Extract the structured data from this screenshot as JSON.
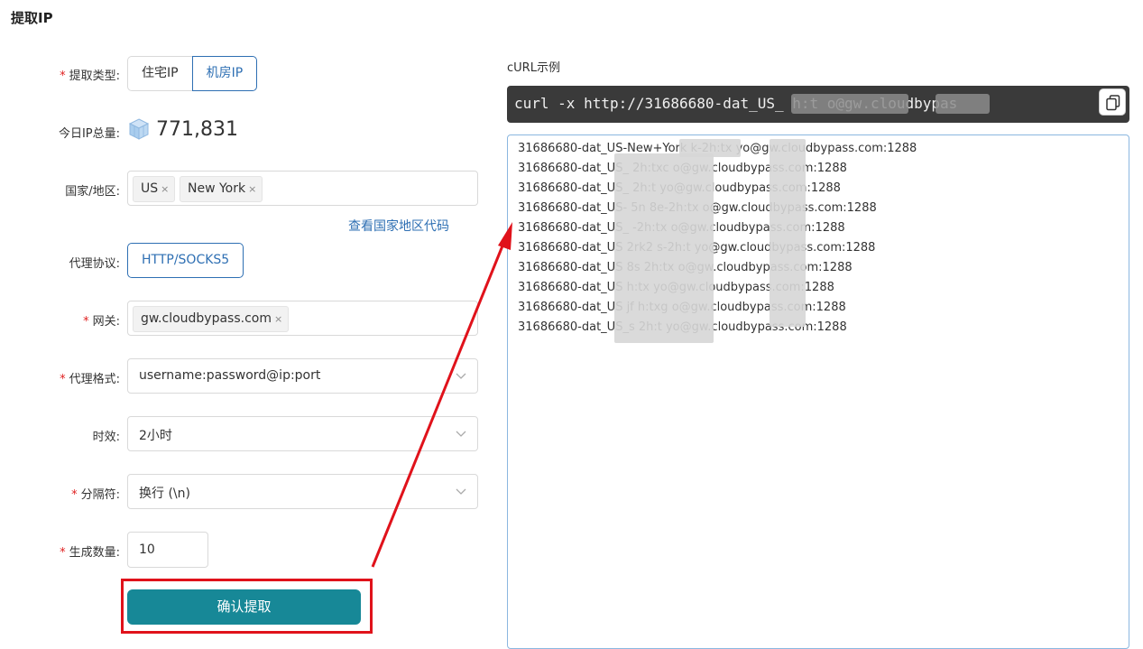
{
  "page": {
    "title": "提取IP"
  },
  "form": {
    "extract_type": {
      "label": "提取类型:",
      "options": [
        "住宅IP",
        "机房IP"
      ],
      "selected": "机房IP"
    },
    "today_total": {
      "label": "今日IP总量:",
      "value": "771,831"
    },
    "country": {
      "label": "国家/地区:",
      "tags": [
        "US",
        "New York"
      ],
      "remove_symbol": "×",
      "lookup_link": "查看国家地区代码"
    },
    "protocol": {
      "label": "代理协议:",
      "value": "HTTP/SOCKS5"
    },
    "gateway": {
      "label": "网关:",
      "tags": [
        "gw.cloudbypass.com"
      ]
    },
    "format": {
      "label": "代理格式:",
      "value": "username:password@ip:port"
    },
    "duration": {
      "label": "时效:",
      "value": "2小时"
    },
    "separator": {
      "label": "分隔符:",
      "value": "换行 (\\n)"
    },
    "quantity": {
      "label": "生成数量:",
      "value": "10"
    },
    "required_mark": "*",
    "confirm_label": "确认提取"
  },
  "curl": {
    "title": "cURL示例",
    "command": "curl -x http://31686680-dat_US_         h:t       o@gw.cloudbypas"
  },
  "results": [
    "31686680-dat_US-New+York          k-2h:tx     yo@gw.cloudbypass.com:1288",
    "31686680-dat_US_            2h:txc     o@gw.cloudbypass.com:1288",
    "31686680-dat_US_            2h:t      yo@gw.cloudbypass.com:1288",
    "31686680-dat_US-           5n       8e-2h:tx       o@gw.cloudbypass.com:1288",
    "31686680-dat_US_            -2h:tx       o@gw.cloudbypass.com:1288",
    "31686680-dat_US           2rk2      s-2h:t     yo@gw.cloudbypass.com:1288",
    "31686680-dat_US           8s      2h:tx       o@gw.cloudbypass.com:1288",
    "31686680-dat_US            h:tx      yo@gw.cloudbypass.com:1288",
    "31686680-dat_US          jf       h:txg      o@gw.cloudbypass.com:1288",
    "31686680-dat_US_s         2h:t      yo@gw.cloudbypass.com:1288"
  ],
  "colors": {
    "accent": "#2e6fb3",
    "confirm": "#178897",
    "highlight": "#e0121b",
    "required": "#e02020"
  },
  "icons": {
    "copy": "copy-icon",
    "chevron": "chevron-down-icon",
    "cube": "ip-cube-icon",
    "arrow": "annotation-arrow"
  }
}
